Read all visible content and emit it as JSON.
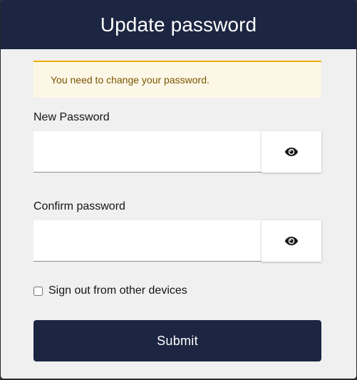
{
  "header": {
    "title": "Update password"
  },
  "alert": {
    "message": "You need to change your password."
  },
  "new_password": {
    "label": "New Password",
    "value": "",
    "toggle_icon": "eye-icon"
  },
  "confirm_password": {
    "label": "Confirm password",
    "value": "",
    "toggle_icon": "eye-icon"
  },
  "logout_sessions": {
    "label": "Sign out from other devices",
    "checked": false
  },
  "submit": {
    "label": "Submit"
  },
  "colors": {
    "header_bg": "#1c2541",
    "alert_border": "#f0ab00",
    "alert_bg": "#fdf7e7",
    "alert_text": "#795600"
  }
}
